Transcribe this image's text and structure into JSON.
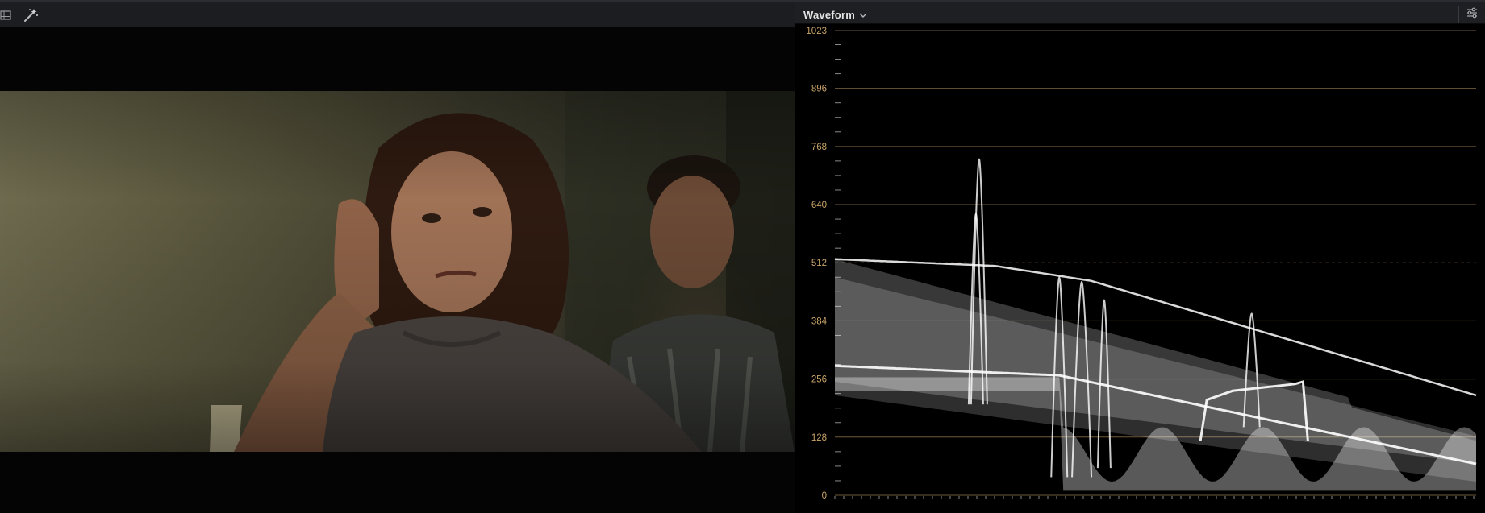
{
  "viewer": {
    "toolbar": {
      "icons": [
        "viewer-layout-icon",
        "magic-wand-icon"
      ]
    }
  },
  "scope": {
    "title": "Waveform",
    "dropdown_icon": "chevron-down-icon",
    "settings_icon": "sliders-icon",
    "scale": {
      "min": 0,
      "max": 1023,
      "labels": [
        "1023",
        "896",
        "768",
        "640",
        "512",
        "384",
        "256",
        "128",
        "0"
      ],
      "values": [
        1023,
        896,
        768,
        640,
        512,
        384,
        256,
        128,
        0
      ],
      "dashed_value": 512
    },
    "colors": {
      "scale_label": "#c9a468",
      "gridline": "#7a6440",
      "trace": "#ffffff",
      "background": "#000000"
    }
  }
}
